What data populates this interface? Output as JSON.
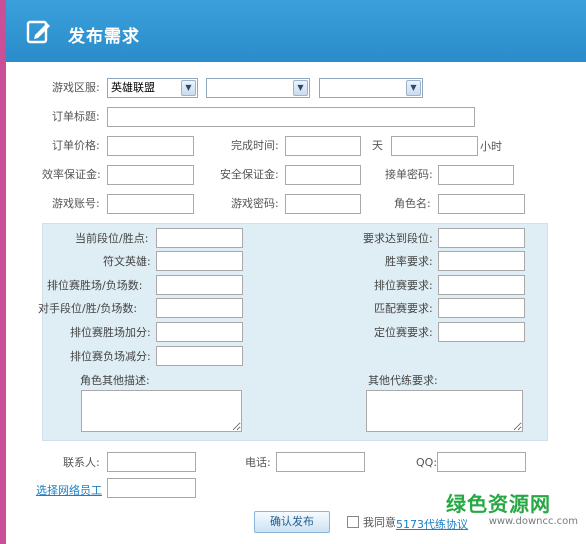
{
  "title": "发布需求",
  "form": {
    "game_server_label": "游戏区服:",
    "game_server_value": "英雄联盟",
    "order_title_label": "订单标题:",
    "order_price_label": "订单价格:",
    "finish_time_label": "完成时间:",
    "day_unit": "天",
    "hour_unit": "小时",
    "efficiency_deposit_label": "效率保证金:",
    "security_deposit_label": "安全保证金:",
    "accept_password_label": "接单密码:",
    "game_account_label": "游戏账号:",
    "game_password_label": "游戏密码:",
    "role_name_label": "角色名:"
  },
  "panel": {
    "current_rank_label": "当前段位/胜点:",
    "target_rank_label": "要求达到段位:",
    "rune_hero_label": "符文英雄:",
    "win_rate_label": "胜率要求:",
    "ranked_record_label": "排位赛胜场/负场数:",
    "ranked_req_label": "排位赛要求:",
    "opponent_label": "对手段位/胜/负场数:",
    "normal_req_label": "匹配赛要求:",
    "ranked_win_points_label": "排位赛胜场加分:",
    "placement_req_label": "定位赛要求:",
    "ranked_loss_points_label": "排位赛负场减分:",
    "role_desc_label": "角色其他描述:",
    "other_req_label": "其他代练要求:"
  },
  "contact": {
    "contact_label": "联系人:",
    "phone_label": "电话:",
    "qq_label": "QQ:",
    "pick_staff_link": "选择网络员工"
  },
  "footer": {
    "submit_label": "确认发布",
    "agree_label": "我同意",
    "agreement_link": "5173代练协议"
  },
  "watermark": {
    "brand": "绿色资源网",
    "url": "www.downcc.com"
  },
  "colors": {
    "titlebar": "#2a8cca",
    "panel": "#dfeef5",
    "link": "#1a7fc6",
    "watermark": "#27a845"
  }
}
